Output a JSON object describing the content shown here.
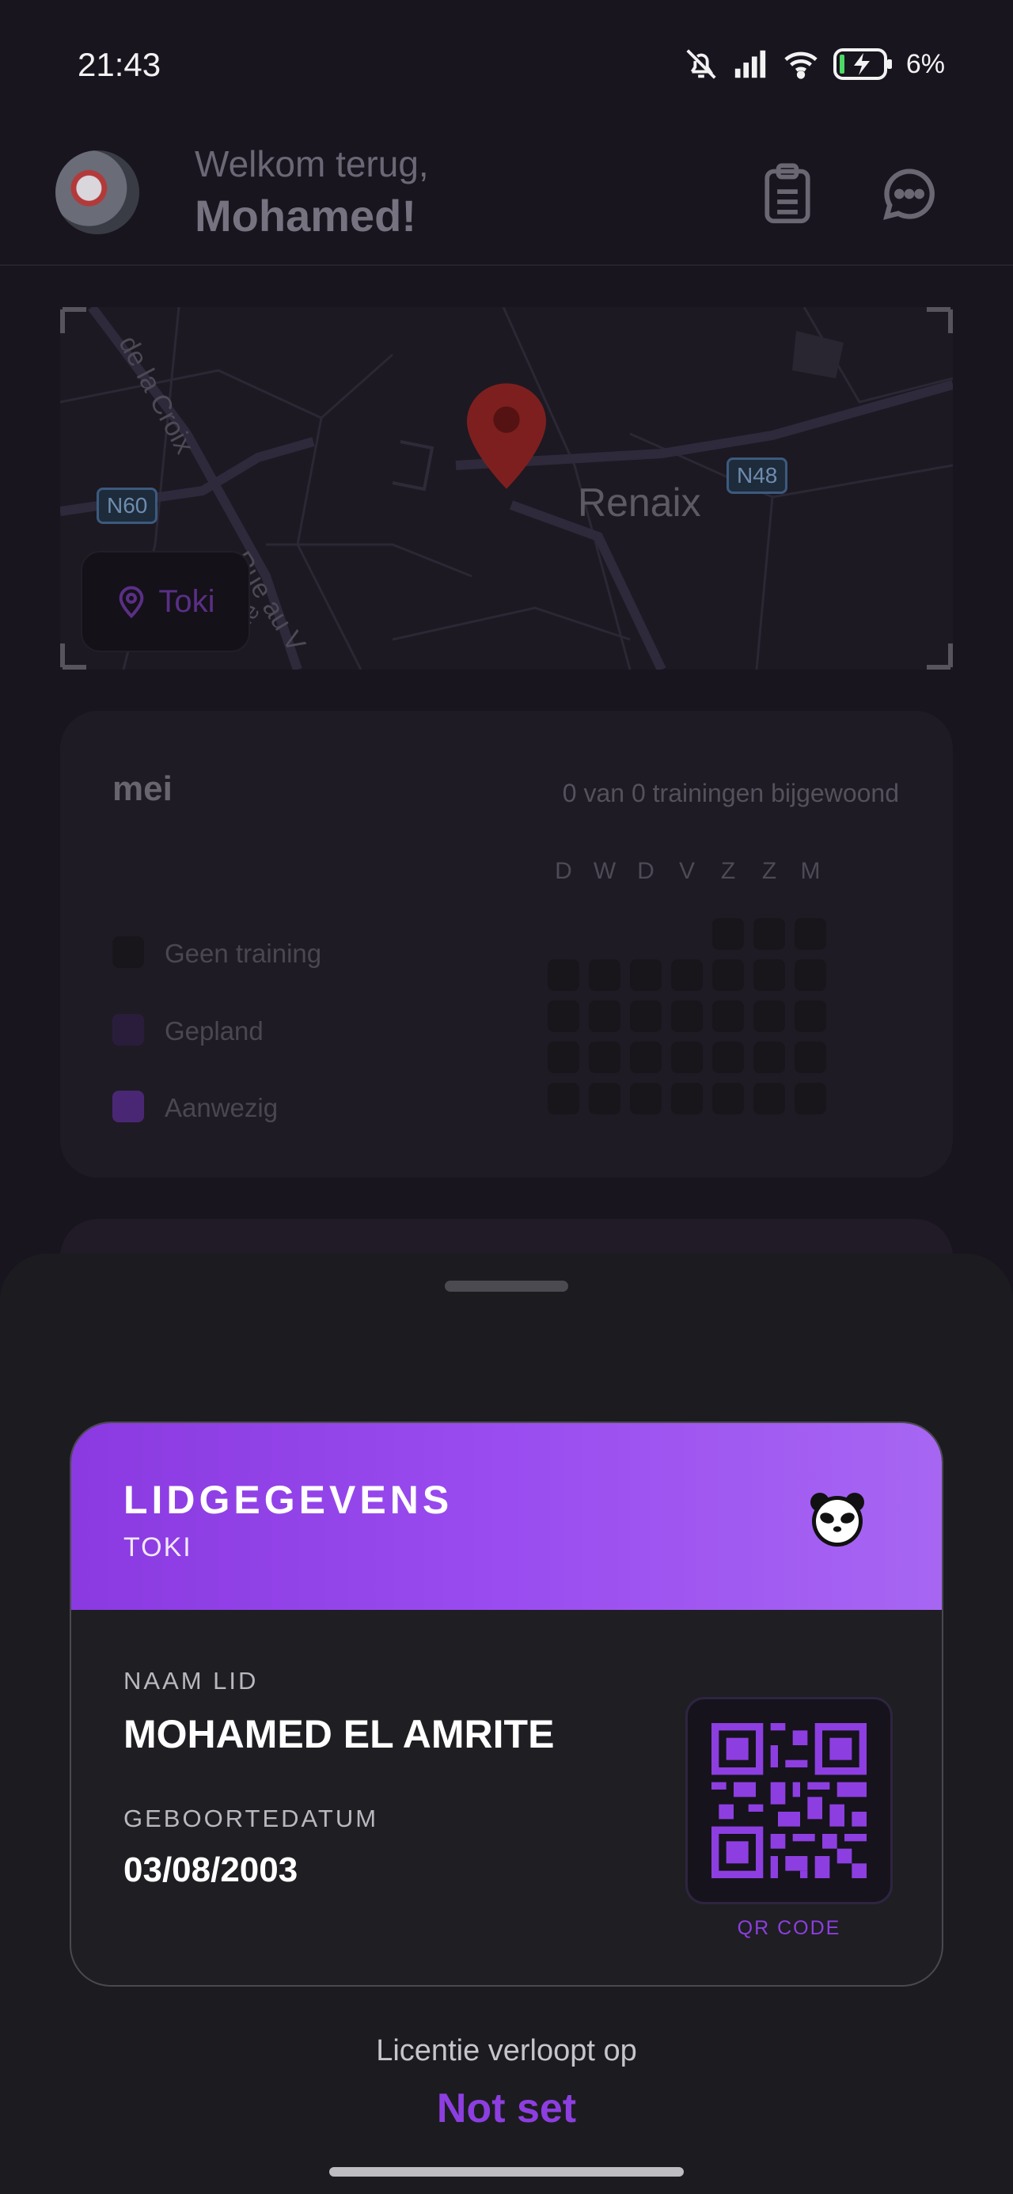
{
  "status_bar": {
    "time": "21:43",
    "battery": "6%"
  },
  "header": {
    "greeting": "Welkom terug,",
    "name": "Mohamed!",
    "icons": [
      "clipboard-icon",
      "chat-icon"
    ]
  },
  "map": {
    "labels": {
      "road_n60": "N60",
      "road_n48": "N48",
      "city": "Renaix",
      "street_1": "de la Croix",
      "street_2": "Rue au V",
      "street_3": "eille"
    },
    "location_badge": "Toki"
  },
  "attendance": {
    "month": "mei",
    "summary": "0 van 0 trainingen bijgewoond",
    "weekdays": [
      "D",
      "W",
      "D",
      "V",
      "Z",
      "Z",
      "M"
    ],
    "legend": [
      {
        "label": "Geen training",
        "color": "#18161b"
      },
      {
        "label": "Gepland",
        "color": "#2a1d3c"
      },
      {
        "label": "Aanwezig",
        "color": "#4a2775"
      }
    ]
  },
  "member_card": {
    "title": "LIDGEGEVENS",
    "club": "TOKI",
    "name_label": "NAAM LID",
    "name_value": "MOHAMED EL AMRITE",
    "dob_label": "GEBOORTEDATUM",
    "dob_value": "03/08/2003",
    "qr_label": "QR CODE",
    "accent_color": "#8d3ee0"
  },
  "license": {
    "label": "Licentie verloopt op",
    "value": "Not set"
  }
}
